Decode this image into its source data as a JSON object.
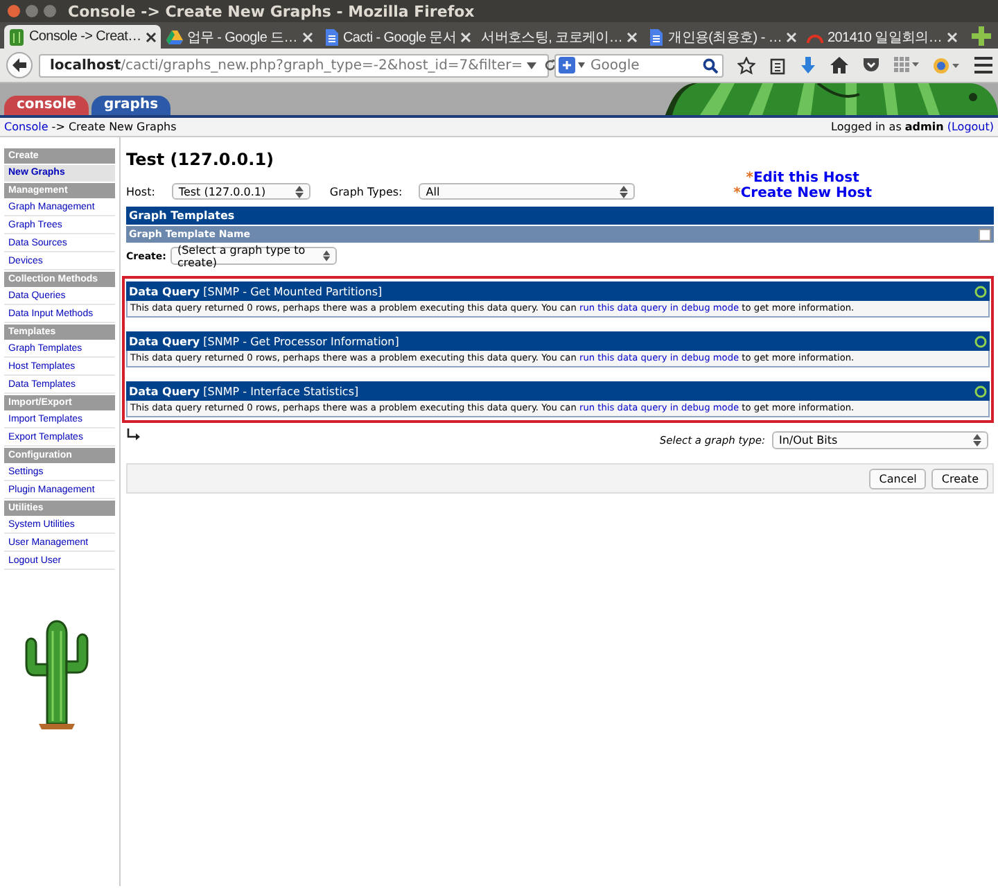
{
  "window": {
    "title": "Console -> Create New Graphs - Mozilla Firefox"
  },
  "browser_tabs": [
    {
      "title": "Console -> Creat…",
      "kind": "cacti",
      "selected": true
    },
    {
      "title": "업무 - Google 드…",
      "kind": "drive",
      "selected": false
    },
    {
      "title": "Cacti - Google 문서",
      "kind": "doc",
      "selected": false
    },
    {
      "title": "서버호스팅, 코로케이…",
      "kind": "plain",
      "selected": false
    },
    {
      "title": "개인용(최용호) - …",
      "kind": "doc",
      "selected": false
    },
    {
      "title": "201410 일일회의…",
      "kind": "arc",
      "selected": false
    }
  ],
  "address_bar": {
    "url": "**localhost**/cacti/graphs_new.php?graph_type=-2&host_id=7&filter="
  },
  "search_field": {
    "placeholder": "Google"
  },
  "app_tabs": [
    {
      "label": "console",
      "color": "#c8454a"
    },
    {
      "label": "graphs",
      "color": "#2c5aa8"
    }
  ],
  "breadcrumb": {
    "link": "Console",
    "rest": " -> Create New Graphs"
  },
  "login": {
    "text": "Logged in as **admin**",
    "logout": "(Logout)"
  },
  "sidebar": [
    {
      "heading": "Create",
      "items": [
        {
          "label": "New Graphs",
          "selected": true
        }
      ]
    },
    {
      "heading": "Management",
      "items": [
        {
          "label": "Graph Management",
          "selected": false
        },
        {
          "label": "Graph Trees",
          "selected": false
        },
        {
          "label": "Data Sources",
          "selected": false
        },
        {
          "label": "Devices",
          "selected": false
        }
      ]
    },
    {
      "heading": "Collection Methods",
      "items": [
        {
          "label": "Data Queries",
          "selected": false
        },
        {
          "label": "Data Input Methods",
          "selected": false
        }
      ]
    },
    {
      "heading": "Templates",
      "items": [
        {
          "label": "Graph Templates",
          "selected": false
        },
        {
          "label": "Host Templates",
          "selected": false
        },
        {
          "label": "Data Templates",
          "selected": false
        }
      ]
    },
    {
      "heading": "Import/Export",
      "items": [
        {
          "label": "Import Templates",
          "selected": false
        },
        {
          "label": "Export Templates",
          "selected": false
        }
      ]
    },
    {
      "heading": "Configuration",
      "items": [
        {
          "label": "Settings",
          "selected": false
        },
        {
          "label": "Plugin Management",
          "selected": false
        }
      ]
    },
    {
      "heading": "Utilities",
      "items": [
        {
          "label": "System Utilities",
          "selected": false
        },
        {
          "label": "User Management",
          "selected": false
        },
        {
          "label": "Logout User",
          "selected": false
        }
      ]
    }
  ],
  "page_title": "Test (127.0.0.1)",
  "host": {
    "label": "Host:",
    "value": "Test (127.0.0.1)"
  },
  "graph_types": {
    "label": "Graph Types:",
    "value": "All"
  },
  "host_links": [
    {
      "mark": "*",
      "label": "Edit this Host"
    },
    {
      "mark": "*",
      "label": "Create New Host"
    }
  ],
  "graph_templates": {
    "title": "Graph Templates",
    "column": "Graph Template Name",
    "checked": false,
    "create_label": "Create:",
    "create_value": "(Select a graph type to create)"
  },
  "data_queries": [
    {
      "label": "Data Query",
      "name": "[SNMP - Get Mounted Partitions]",
      "message": "This data query returned 0 rows, perhaps there was a problem executing this data query. You can",
      "link": "run this data query in debug mode",
      "message_end": "to get more information."
    },
    {
      "label": "Data Query",
      "name": "[SNMP - Get Processor Information]",
      "message": "This data query returned 0 rows, perhaps there was a problem executing this data query. You can",
      "link": "run this data query in debug mode",
      "message_end": "to get more information."
    },
    {
      "label": "Data Query",
      "name": "[SNMP - Interface Statistics]",
      "message": "This data query returned 0 rows, perhaps there was a problem executing this data query. You can",
      "link": "run this data query in debug mode",
      "message_end": "to get more information."
    }
  ],
  "graph_type_select": {
    "label": "Select a graph type:",
    "value": "In/Out Bits"
  },
  "buttons": [
    "Cancel",
    "Create"
  ]
}
